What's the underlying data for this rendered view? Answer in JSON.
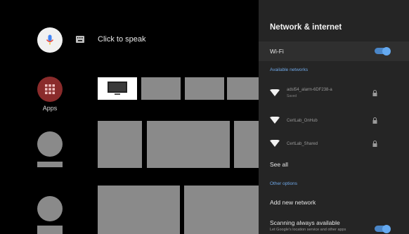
{
  "home": {
    "speak_prompt": "Click to speak",
    "apps_label": "Apps",
    "icons": {
      "mic": "microphone-icon",
      "keyboard": "keyboard-icon",
      "apps": "apps-grid-icon"
    }
  },
  "panel": {
    "title": "Network & internet",
    "wifi_label": "Wi-Fi",
    "wifi_on": true,
    "available_header": "Available networks",
    "networks": [
      {
        "name": "adsl54_alarm-6DF238-a",
        "sub": "Saved",
        "secured": true
      },
      {
        "name": "CertLab_OnHub",
        "sub": "",
        "secured": true
      },
      {
        "name": "CertLab_Shared",
        "sub": "",
        "secured": true
      }
    ],
    "see_all": "See all",
    "other_header": "Other options",
    "add_network": "Add new network",
    "scanning_title": "Scanning always available",
    "scanning_desc": "Let Google's location service and other apps",
    "scanning_on": true
  },
  "colors": {
    "accent": "#4a86c8",
    "panel_bg": "#252525",
    "apps_red": "#8a2b2b"
  }
}
